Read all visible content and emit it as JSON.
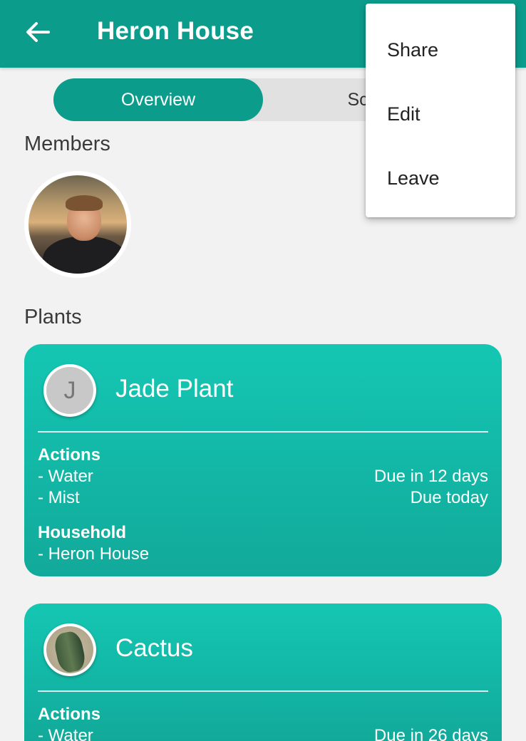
{
  "appbar": {
    "title": "Heron House",
    "back_icon": "arrow-left-icon",
    "color": "#0b9c8c"
  },
  "tabs": [
    {
      "label": "Overview",
      "active": true
    },
    {
      "label": "Sche",
      "active": false
    }
  ],
  "members": {
    "label": "Members"
  },
  "plants": {
    "label": "Plants",
    "cards": [
      {
        "name": "Jade Plant",
        "avatar_letter": "J",
        "actions_label": "Actions",
        "actions": [
          {
            "name": "- Water",
            "due": "Due in 12 days"
          },
          {
            "name": "- Mist",
            "due": "Due today"
          }
        ],
        "household_label": "Household",
        "household": "- Heron House"
      },
      {
        "name": "Cactus",
        "actions_label": "Actions",
        "actions": [
          {
            "name": "- Water",
            "due": "Due in 26 days"
          }
        ]
      }
    ]
  },
  "menu": {
    "items": [
      "Share",
      "Edit",
      "Leave"
    ]
  }
}
